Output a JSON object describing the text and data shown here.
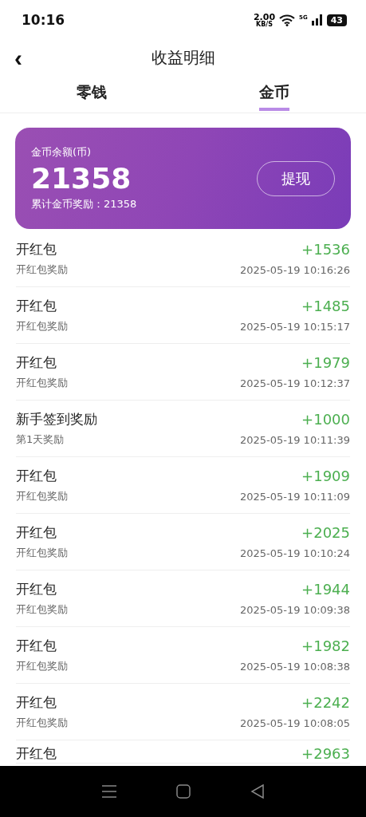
{
  "status_bar": {
    "time": "10:16",
    "speed": "2.00",
    "speed_unit": "KB/S",
    "network": "5G",
    "battery": "43"
  },
  "header": {
    "back": "‹",
    "title": "收益明细"
  },
  "tabs": [
    {
      "label": "零钱",
      "selected": false
    },
    {
      "label": "金币",
      "selected": true
    }
  ],
  "balance_card": {
    "label": "金币余额(币)",
    "amount": "21358",
    "total": "累计金币奖励：21358",
    "button": "提现"
  },
  "records": [
    {
      "title": "开红包",
      "subtitle": "开红包奖励",
      "amount": "+1536",
      "time": "2025-05-19 10:16:26"
    },
    {
      "title": "开红包",
      "subtitle": "开红包奖励",
      "amount": "+1485",
      "time": "2025-05-19 10:15:17"
    },
    {
      "title": "开红包",
      "subtitle": "开红包奖励",
      "amount": "+1979",
      "time": "2025-05-19 10:12:37"
    },
    {
      "title": "新手签到奖励",
      "subtitle": "第1天奖励",
      "amount": "+1000",
      "time": "2025-05-19 10:11:39"
    },
    {
      "title": "开红包",
      "subtitle": "开红包奖励",
      "amount": "+1909",
      "time": "2025-05-19 10:11:09"
    },
    {
      "title": "开红包",
      "subtitle": "开红包奖励",
      "amount": "+2025",
      "time": "2025-05-19 10:10:24"
    },
    {
      "title": "开红包",
      "subtitle": "开红包奖励",
      "amount": "+1944",
      "time": "2025-05-19 10:09:38"
    },
    {
      "title": "开红包",
      "subtitle": "开红包奖励",
      "amount": "+1982",
      "time": "2025-05-19 10:08:38"
    },
    {
      "title": "开红包",
      "subtitle": "开红包奖励",
      "amount": "+2242",
      "time": "2025-05-19 10:08:05"
    },
    {
      "title": "开红包",
      "amount": "+2963"
    }
  ]
}
